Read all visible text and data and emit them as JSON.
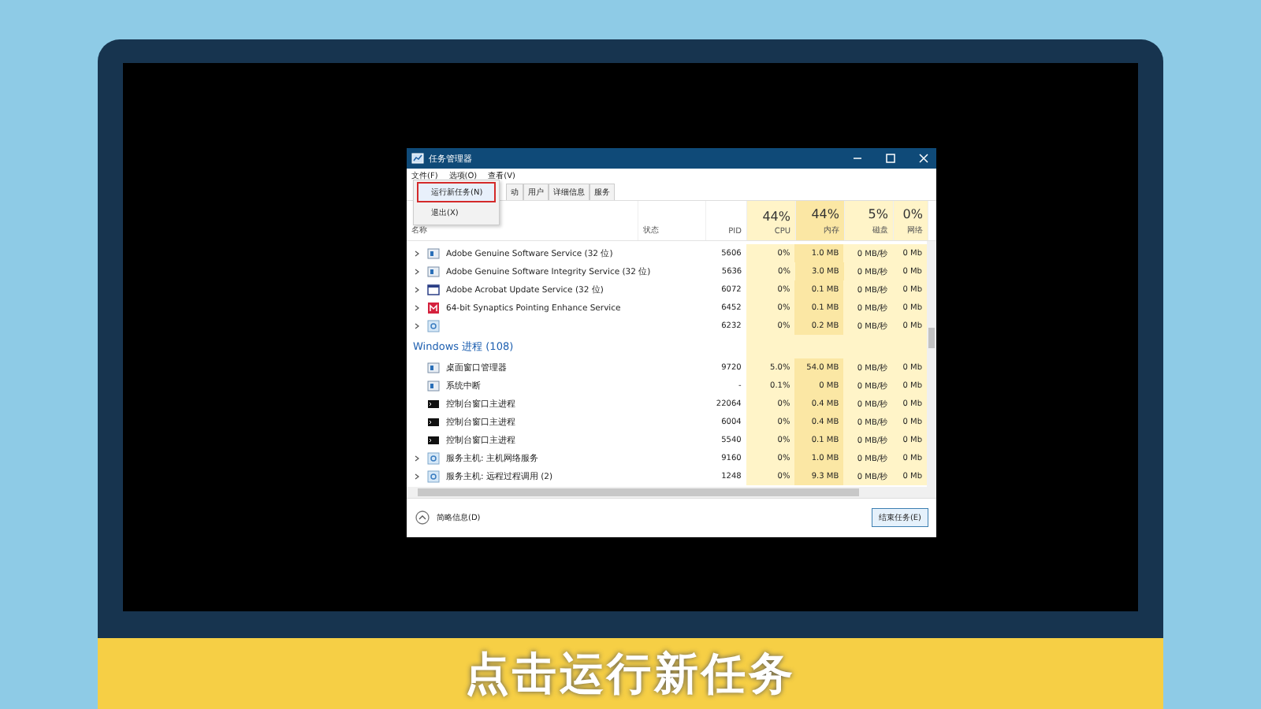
{
  "window": {
    "title": "任务管理器"
  },
  "menu": [
    "文件(F)",
    "选项(O)",
    "查看(V)"
  ],
  "file_menu": [
    {
      "label": "运行新任务(N)",
      "selected": true
    },
    {
      "label": "退出(X)",
      "selected": false
    }
  ],
  "tabs": [
    {
      "label": "动",
      "selected": false
    },
    {
      "label": "用户",
      "selected": false
    },
    {
      "label": "详细信息",
      "selected": false
    },
    {
      "label": "服务",
      "selected": false
    }
  ],
  "columns": {
    "name": "名称",
    "status": "状态",
    "pid": "PID",
    "cpu": {
      "total": "44%",
      "label": "CPU"
    },
    "memory": {
      "total": "44%",
      "label": "内存"
    },
    "disk": {
      "total": "5%",
      "label": "磁盘"
    },
    "network": {
      "total": "0%",
      "label": "网络"
    }
  },
  "apps": [
    {
      "kind": "service",
      "expandable": true,
      "name": "Adobe Genuine Software Service (32 位)",
      "pid": "5606",
      "cpu": "0%",
      "memory": "1.0 MB",
      "disk": "0 MB/秒",
      "network": "0 Mb"
    },
    {
      "kind": "service",
      "expandable": true,
      "name": "Adobe Genuine Software Integrity Service (32 位)",
      "pid": "5636",
      "cpu": "0%",
      "memory": "3.0 MB",
      "disk": "0 MB/秒",
      "network": "0 Mb"
    },
    {
      "kind": "window",
      "expandable": true,
      "name": "Adobe Acrobat Update Service (32 位)",
      "pid": "6072",
      "cpu": "0%",
      "memory": "0.1 MB",
      "disk": "0 MB/秒",
      "network": "0 Mb"
    },
    {
      "kind": "synaptics",
      "expandable": true,
      "name": "64-bit Synaptics Pointing Enhance Service",
      "pid": "6452",
      "cpu": "0%",
      "memory": "0.1 MB",
      "disk": "0 MB/秒",
      "network": "0 Mb"
    },
    {
      "kind": "gear",
      "expandable": true,
      "pid": "6232",
      "cpu": "0%",
      "memory": "0.2 MB",
      "disk": "0 MB/秒",
      "network": "0 Mb"
    }
  ],
  "group": "Windows 进程 (108)",
  "windows_processes": [
    {
      "kind": "service",
      "expandable": false,
      "name": "桌面窗口管理器",
      "pid": "9720",
      "cpu": "5.0%",
      "memory": "54.0 MB",
      "disk": "0 MB/秒",
      "network": "0 Mb"
    },
    {
      "kind": "service",
      "expandable": false,
      "name": "系统中断",
      "pid": "-",
      "cpu": "0.1%",
      "memory": "0 MB",
      "disk": "0 MB/秒",
      "network": "0 Mb"
    },
    {
      "kind": "console",
      "expandable": false,
      "name": "控制台窗口主进程",
      "pid": "22064",
      "cpu": "0%",
      "memory": "0.4 MB",
      "disk": "0 MB/秒",
      "network": "0 Mb"
    },
    {
      "kind": "console",
      "expandable": false,
      "name": "控制台窗口主进程",
      "pid": "6004",
      "cpu": "0%",
      "memory": "0.4 MB",
      "disk": "0 MB/秒",
      "network": "0 Mb"
    },
    {
      "kind": "console",
      "expandable": false,
      "name": "控制台窗口主进程",
      "pid": "5540",
      "cpu": "0%",
      "memory": "0.1 MB",
      "disk": "0 MB/秒",
      "network": "0 Mb"
    },
    {
      "kind": "gear",
      "expandable": true,
      "name": "服务主机: 主机网络服务",
      "pid": "9160",
      "cpu": "0%",
      "memory": "1.0 MB",
      "disk": "0 MB/秒",
      "network": "0 Mb"
    },
    {
      "kind": "gear",
      "expandable": true,
      "name": "服务主机: 远程过程调用 (2)",
      "pid": "1248",
      "cpu": "0%",
      "memory": "9.3 MB",
      "disk": "0 MB/秒",
      "network": "0 Mb"
    }
  ],
  "footer": {
    "details": "简略信息(D)",
    "end_task": "结束任务(E)"
  },
  "caption": "点击运行新任务"
}
